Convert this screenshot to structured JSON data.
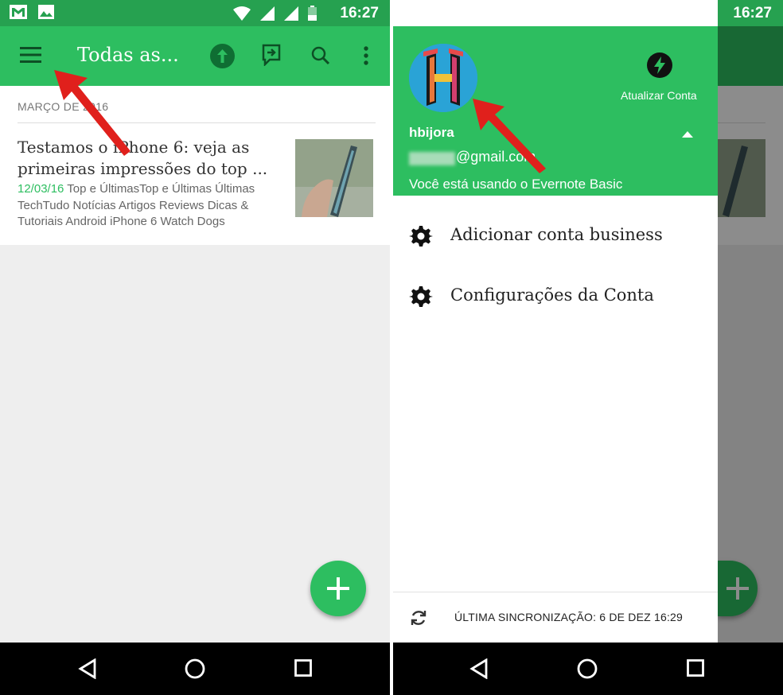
{
  "status_bar": {
    "time": "16:27"
  },
  "left": {
    "toolbar": {
      "title": "Todas as..."
    },
    "section_label": "MARÇO DE 2016",
    "note": {
      "title": "Testamos o iPhone 6: veja as primeiras impressões do top ...",
      "date": "12/03/16",
      "tags": " Top e ÚltimasTop e Últimas Últimas TechTudo Notícias Artigos Reviews Dicas & Tutoriais Android iPhone 6 Watch Dogs"
    }
  },
  "right": {
    "drawer": {
      "upgrade_label": "Atualizar Conta",
      "username": "hbijora",
      "email": "@gmail.com",
      "plan_text": "Você está usando o Evernote Basic",
      "menu_items": [
        {
          "label": "Adicionar conta business"
        },
        {
          "label": "Configurações da Conta"
        }
      ],
      "sync_label": "ÚLTIMA SINCRONIZAÇÃO: 6 DE DEZ 16:29"
    }
  },
  "colors": {
    "brand_green": "#2dbe60",
    "status_green": "#26a150",
    "annotation_red": "#e0201c"
  }
}
